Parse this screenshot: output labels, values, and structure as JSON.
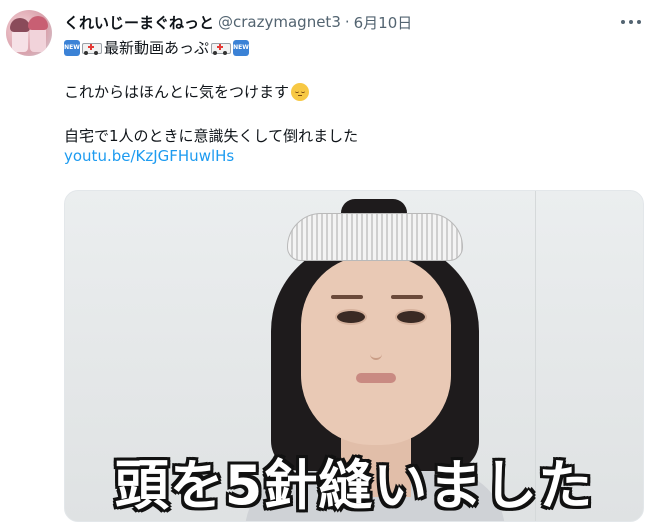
{
  "tweet": {
    "display_name": "くれいじーまぐねっと",
    "handle": "@crazymagnet3",
    "separator": "·",
    "date": "6月10日",
    "lines": {
      "headline_text": "最新動画あっぷ",
      "line2": "これからはほんとに気をつけます",
      "line3": "自宅で1人のときに意識失くして倒れました",
      "link": "youtu.be/KzJGFHuwlHs"
    },
    "badge_text": "NEW",
    "icons": [
      "new-badge-icon",
      "ambulance-icon",
      "pensive-face-icon",
      "more-icon"
    ]
  },
  "media": {
    "caption": "頭を5針縫いました"
  },
  "colors": {
    "text": "#0f1419",
    "muted": "#536471",
    "link": "#1d9bf0",
    "new_badge": "#3b82d6"
  }
}
